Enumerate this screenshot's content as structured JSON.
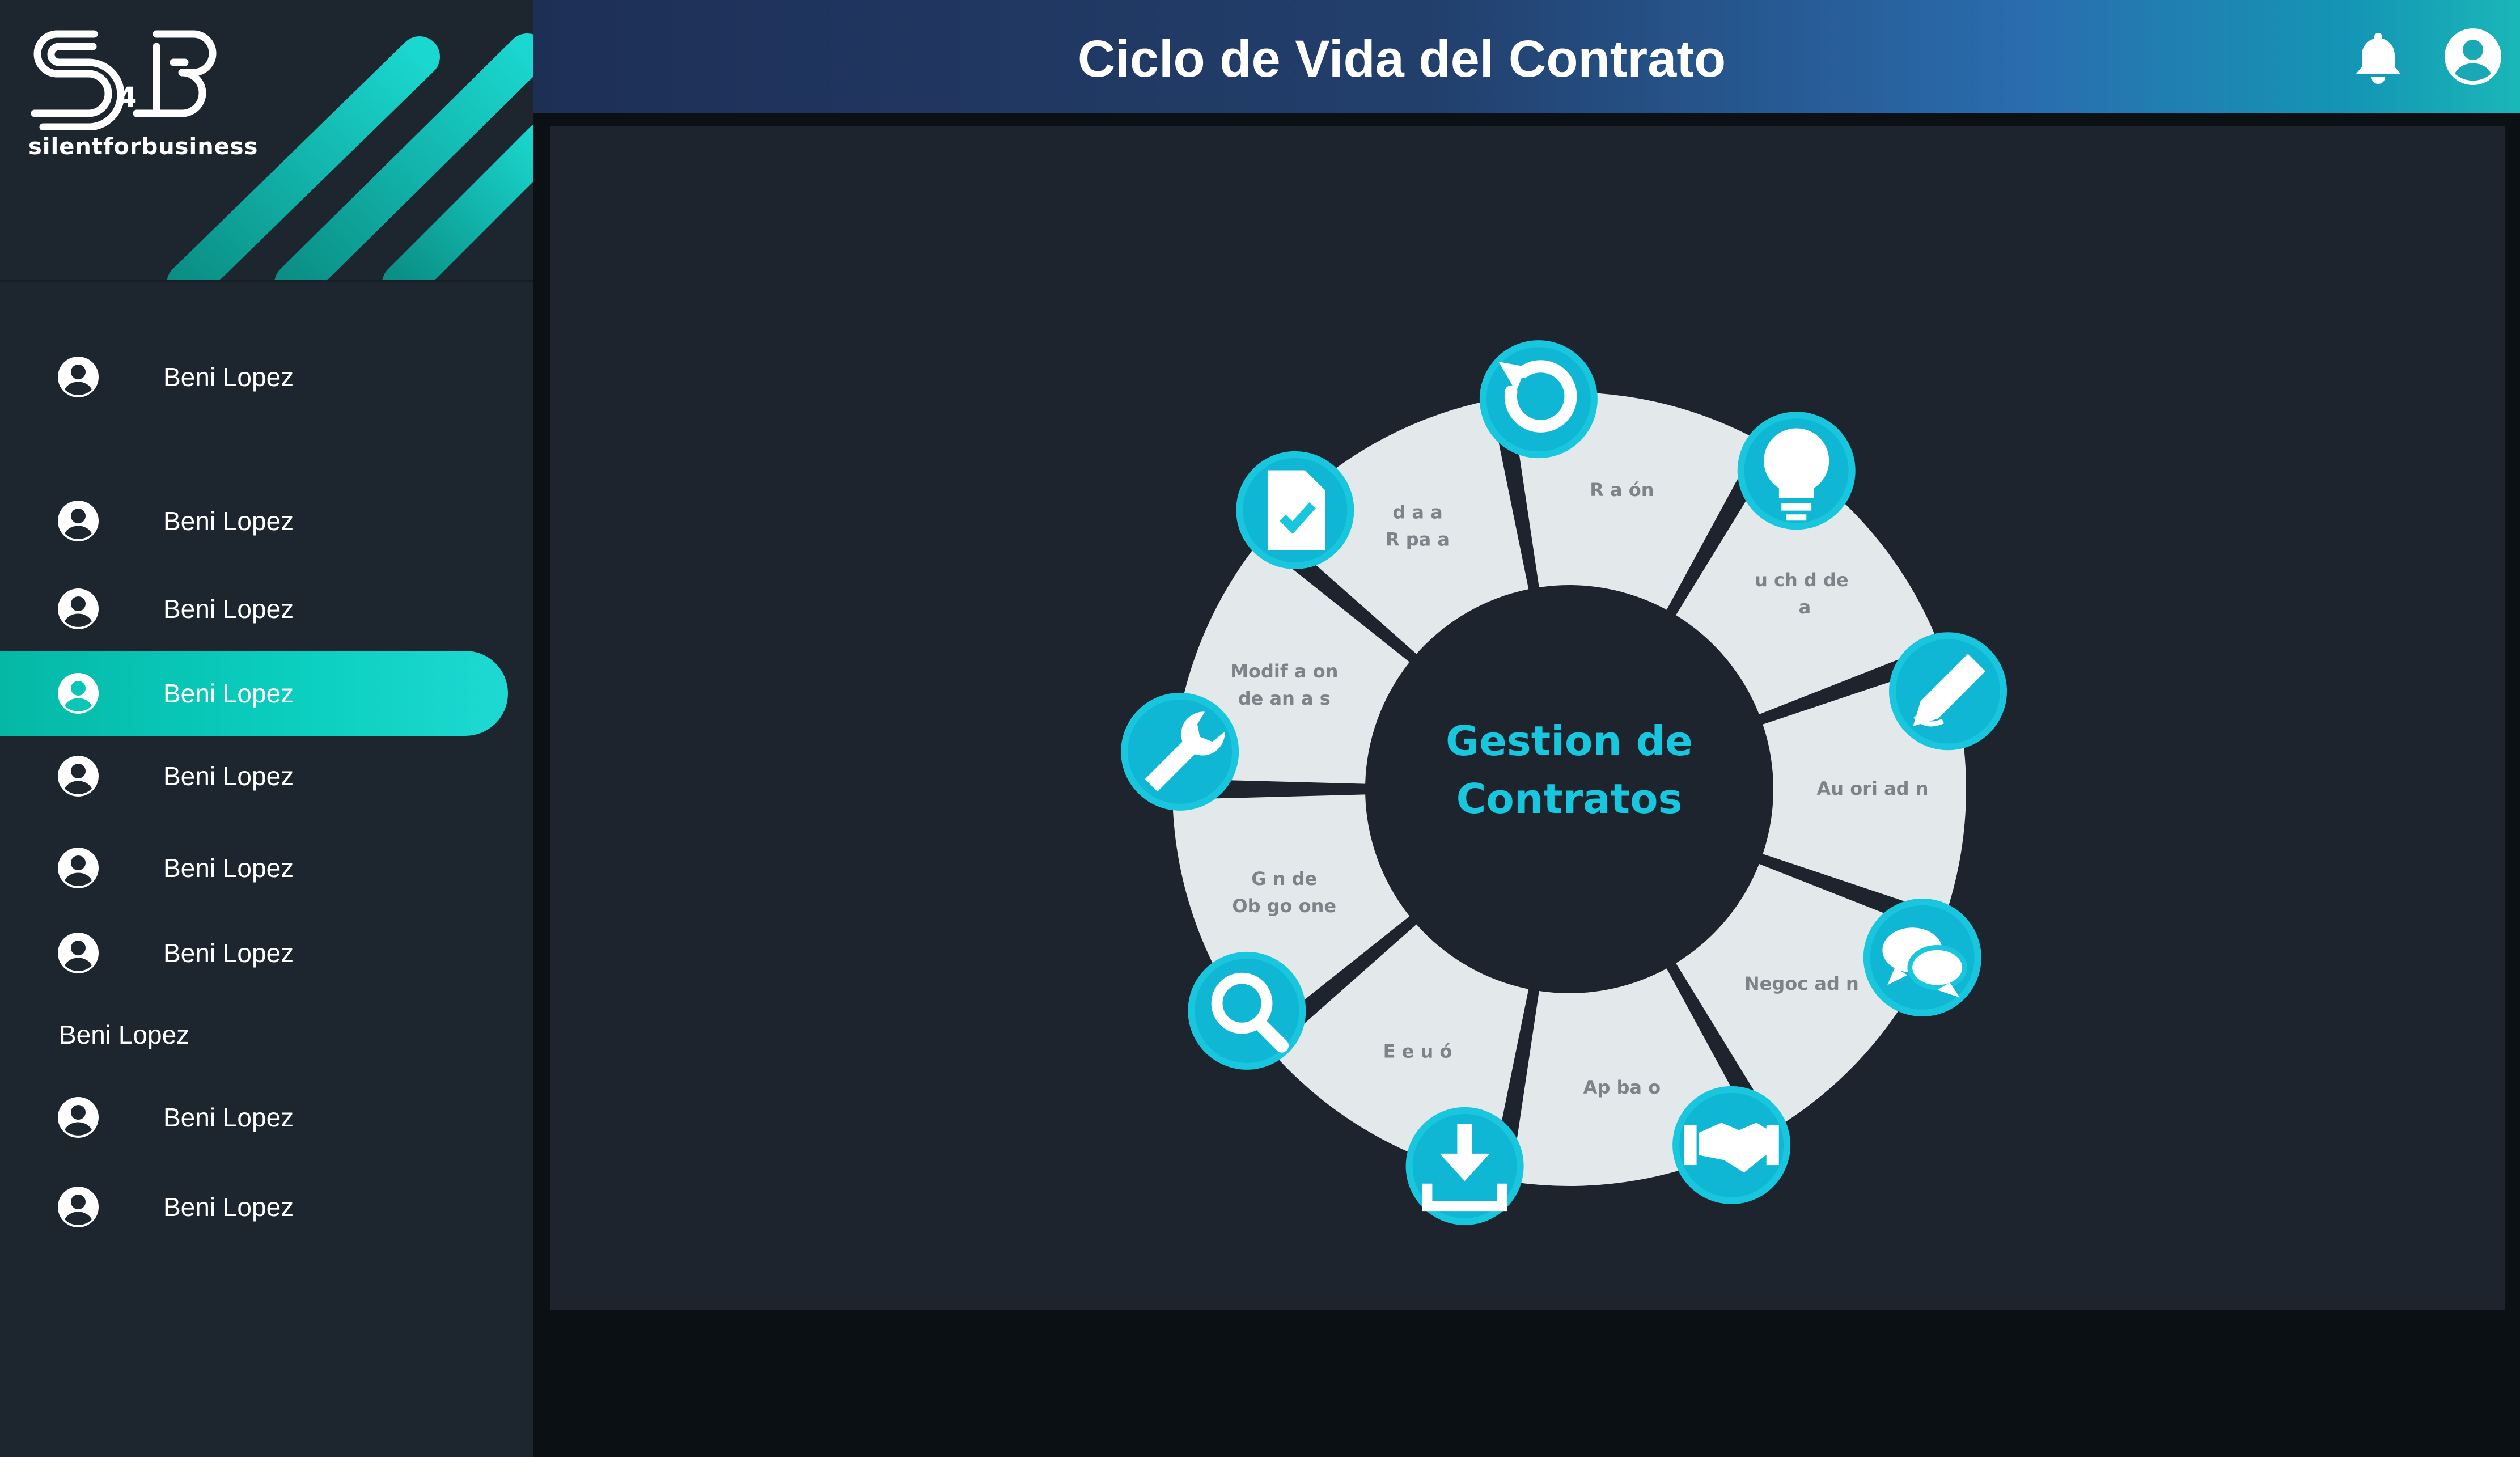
{
  "brand": {
    "logo_mark": "S4B",
    "name": "silentforbusiness"
  },
  "header": {
    "title": "Ciclo de Vida del Contrato",
    "bell_icon": "bell-icon",
    "user_icon": "user-circle-icon"
  },
  "sidebar": {
    "items": [
      {
        "label": "Beni Lopez",
        "icon": "user-circle-icon",
        "active": false
      },
      {
        "label": "Beni Lopez",
        "icon": "user-circle-icon",
        "active": false
      },
      {
        "label": "Beni Lopez",
        "icon": "user-circle-icon",
        "active": false
      },
      {
        "label": "Beni Lopez",
        "icon": "user-circle-icon",
        "active": true
      },
      {
        "label": "Beni Lopez",
        "icon": "user-circle-icon",
        "active": false
      },
      {
        "label": "Beni Lopez",
        "icon": "user-circle-icon",
        "active": false
      },
      {
        "label": "Beni Lopez",
        "icon": "user-circle-icon",
        "active": false
      },
      {
        "label": "Beni Lopez",
        "icon": "",
        "active": false
      },
      {
        "label": "Beni Lopez",
        "icon": "user-circle-icon",
        "active": false
      },
      {
        "label": "Beni Lopez",
        "icon": "user-circle-icon",
        "active": false
      }
    ]
  },
  "diagram": {
    "center_line1": "Gestion de",
    "center_line2": "Contratos",
    "segments": [
      {
        "label": "R   a  ón",
        "icon": "refresh-icon"
      },
      {
        "label": "u  ch  d de\n    a ",
        "icon": "lightbulb-icon"
      },
      {
        "label": "Au  ori  ad    n",
        "icon": "pencil-icon"
      },
      {
        "label": "Negoc  ad   n",
        "icon": "chat-icon"
      },
      {
        "label": "Ap  ba    o",
        "icon": "handshake-icon"
      },
      {
        "label": "E e  u    ó",
        "icon": "download-icon"
      },
      {
        "label": "G     n de\nOb  go  one",
        "icon": "search-icon"
      },
      {
        "label": "Modif   a   on\nde   an    a s",
        "icon": "wrench-icon"
      },
      {
        "label": "  d   a   a\nR  pa   a",
        "icon": "document-check-icon"
      }
    ],
    "colors": {
      "accent": "#18c6dd",
      "segment": "#e3e8ea",
      "segment_text": "#7d8489",
      "center": "#1d242d"
    }
  }
}
